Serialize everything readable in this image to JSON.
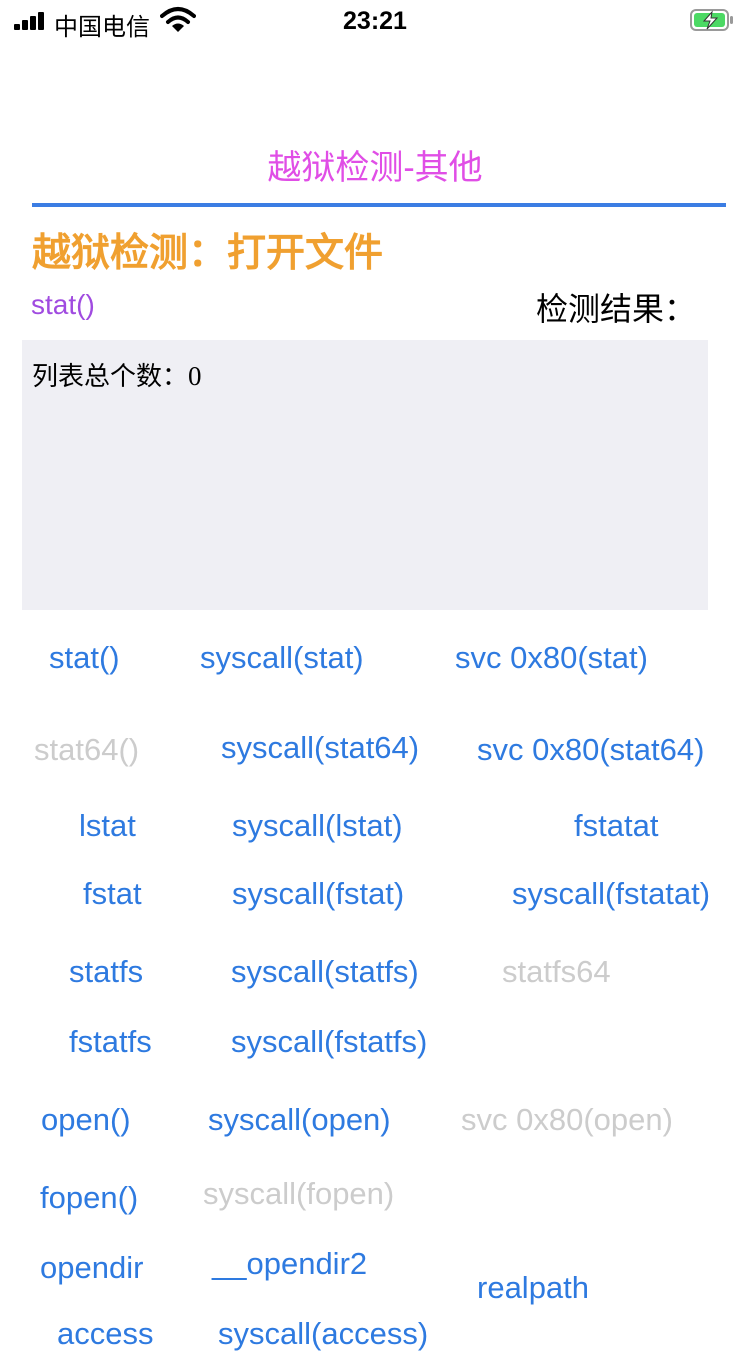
{
  "status_bar": {
    "carrier": "中国电信",
    "time": "23:21"
  },
  "nav": {
    "title": "越狱检测-其他"
  },
  "section": {
    "title": "越狱检测：打开文件",
    "method": "stat()",
    "result_label": "检测结果："
  },
  "result_box": {
    "count_label": "列表总个数：",
    "count_value": "0"
  },
  "buttons": [
    {
      "label": "stat()",
      "enabled": true
    },
    {
      "label": "syscall(stat)",
      "enabled": true
    },
    {
      "label": "svc 0x80(stat)",
      "enabled": true
    },
    {
      "label": "stat64()",
      "enabled": false
    },
    {
      "label": "syscall(stat64)",
      "enabled": true
    },
    {
      "label": "svc 0x80(stat64)",
      "enabled": true
    },
    {
      "label": "lstat",
      "enabled": true
    },
    {
      "label": "syscall(lstat)",
      "enabled": true
    },
    {
      "label": "fstatat",
      "enabled": true
    },
    {
      "label": "fstat",
      "enabled": true
    },
    {
      "label": "syscall(fstat)",
      "enabled": true
    },
    {
      "label": "syscall(fstatat)",
      "enabled": true
    },
    {
      "label": "statfs",
      "enabled": true
    },
    {
      "label": "syscall(statfs)",
      "enabled": true
    },
    {
      "label": "statfs64",
      "enabled": false
    },
    {
      "label": "fstatfs",
      "enabled": true
    },
    {
      "label": "syscall(fstatfs)",
      "enabled": true
    },
    {
      "label": "open()",
      "enabled": true
    },
    {
      "label": "syscall(open)",
      "enabled": true
    },
    {
      "label": "svc 0x80(open)",
      "enabled": false
    },
    {
      "label": "fopen()",
      "enabled": true
    },
    {
      "label": "syscall(fopen)",
      "enabled": false
    },
    {
      "label": "opendir",
      "enabled": true
    },
    {
      "label": "__opendir2",
      "enabled": true
    },
    {
      "label": "realpath",
      "enabled": true
    },
    {
      "label": "access",
      "enabled": true
    },
    {
      "label": "syscall(access)",
      "enabled": true
    }
  ],
  "colors": {
    "nav_title": "#e04ee6",
    "accent_line": "#3b7de3",
    "section_title": "#f0a030",
    "method": "#a04be0",
    "button": "#2e7ae0",
    "button_disabled": "#cccccc",
    "result_bg": "#efeff4"
  }
}
